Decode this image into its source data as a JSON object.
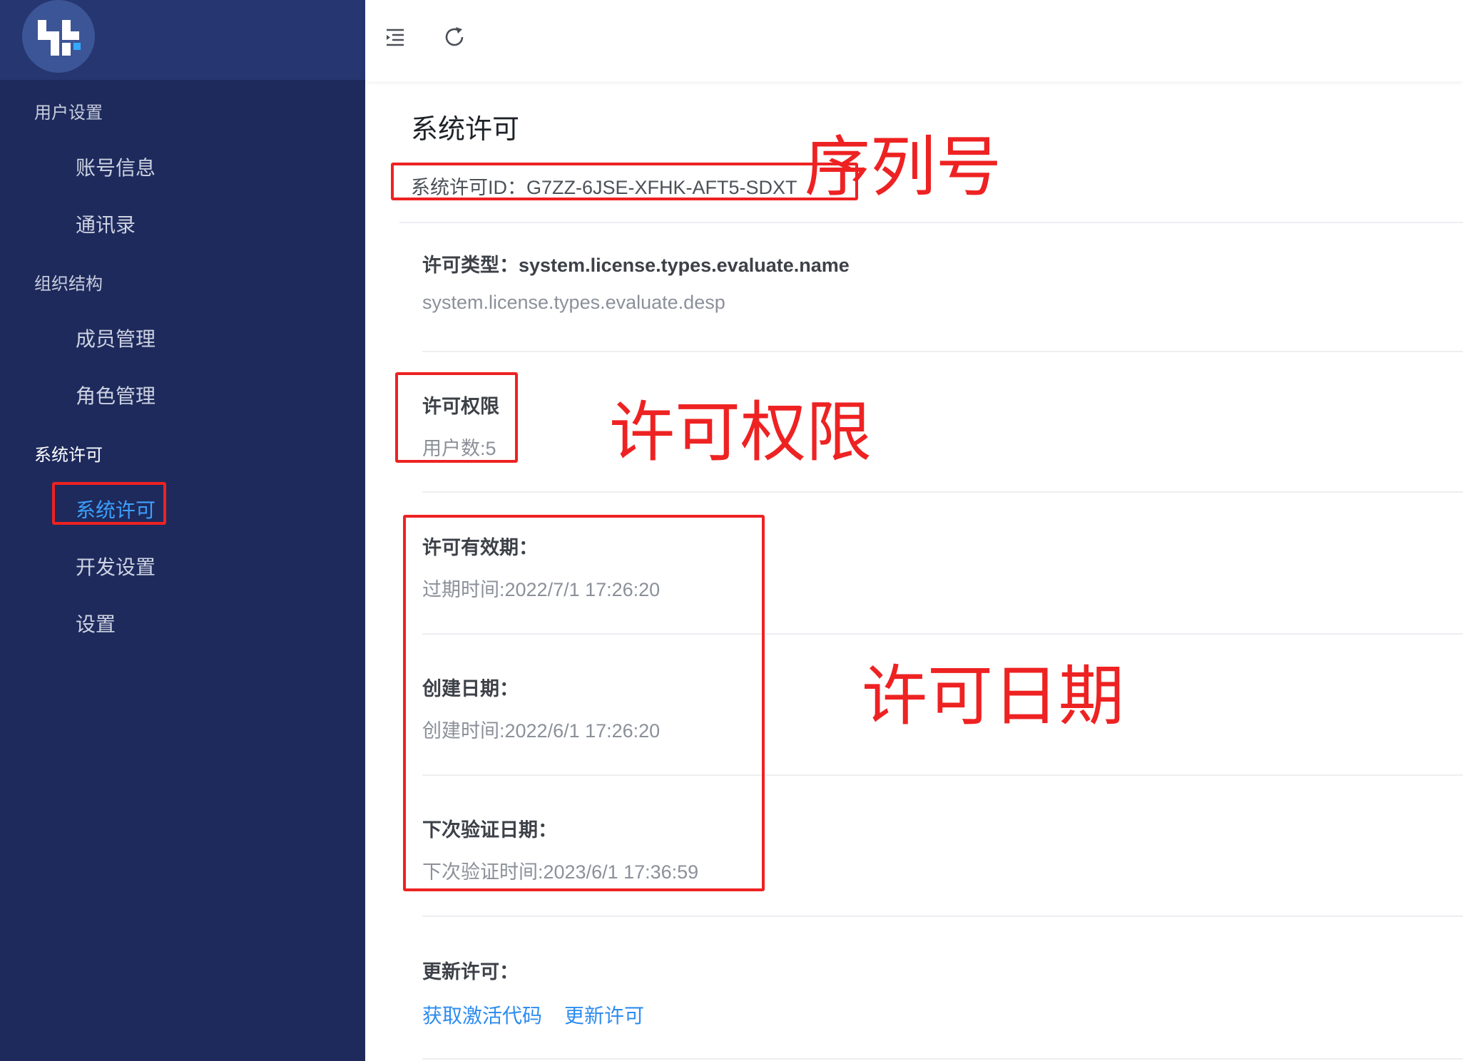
{
  "sidebar": {
    "groups": [
      {
        "label": "用户设置",
        "items": [
          "账号信息",
          "通讯录"
        ]
      },
      {
        "label": "组织结构",
        "items": [
          "成员管理",
          "角色管理"
        ]
      },
      {
        "label": "系统许可",
        "items": [
          "系统许可",
          "开发设置",
          "设置"
        ]
      }
    ],
    "active_item": "系统许可"
  },
  "header": {
    "icons": [
      "menu-fold-icon",
      "refresh-icon"
    ]
  },
  "main": {
    "title": "系统许可",
    "license_id_text": "系统许可ID：G7ZZ-6JSE-XFHK-AFT5-SDXT",
    "license_type_label": "许可类型：system.license.types.evaluate.name",
    "license_type_desc": "system.license.types.evaluate.desp",
    "permission_label": "许可权限",
    "permission_value": "用户数:5",
    "validity_label": "许可有效期：",
    "validity_value": "过期时间:2022/7/1 17:26:20",
    "created_label": "创建日期：",
    "created_value": "创建时间:2022/6/1 17:26:20",
    "next_verify_label": "下次验证日期：",
    "next_verify_value": "下次验证时间:2023/6/1 17:36:59",
    "update_label": "更新许可：",
    "links": [
      "获取激活代码",
      "更新许可"
    ]
  },
  "annotations": [
    "序列号",
    "许可权限",
    "许可日期"
  ],
  "colors": {
    "sidebar_bg": "#1e2a5c",
    "active_menu": "#3ba1ff",
    "link": "#2d8cf0",
    "annotation_red": "#ee2222"
  }
}
